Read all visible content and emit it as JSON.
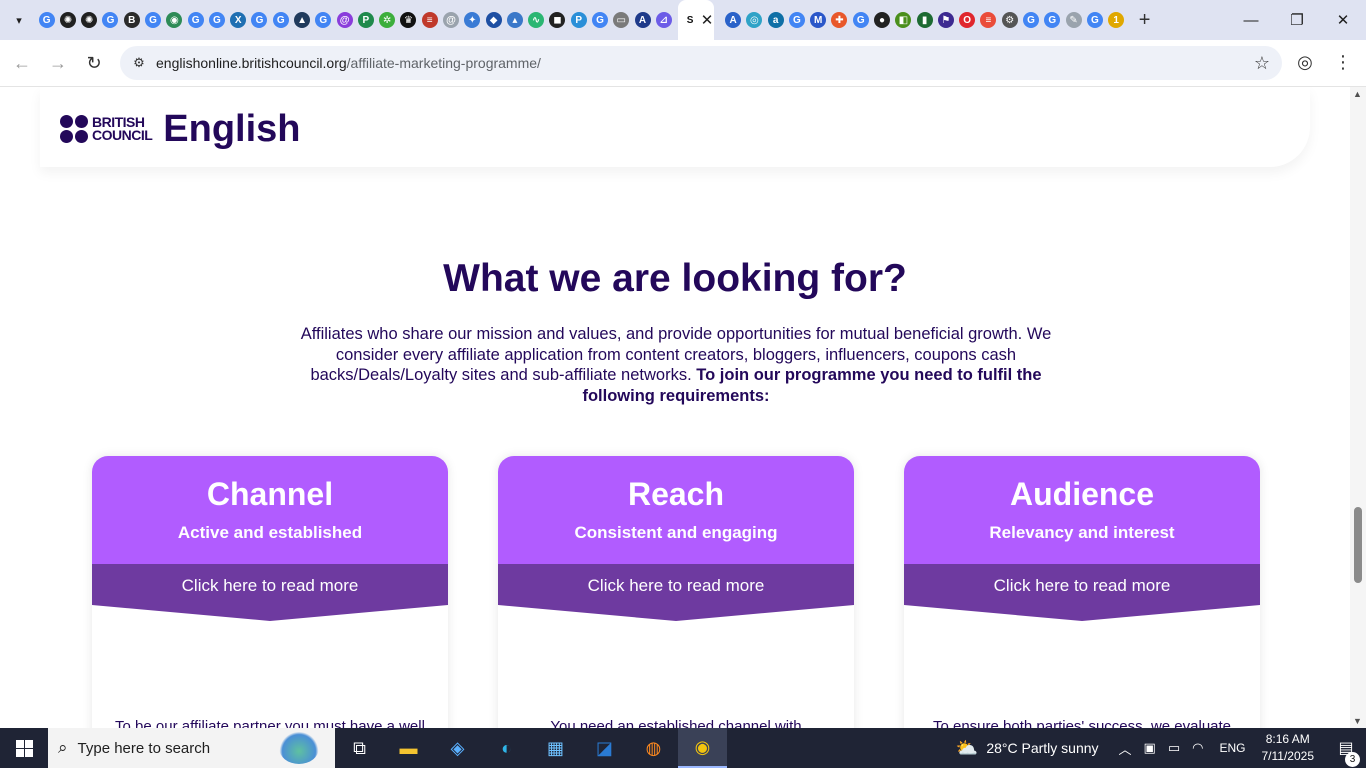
{
  "browser": {
    "tab_icons": [
      {
        "icon": "google-icon",
        "glyph": "G",
        "color": "#4285f4"
      },
      {
        "icon": "chatgpt-icon",
        "glyph": "✺",
        "color": "#202020"
      },
      {
        "icon": "chatgpt-icon",
        "glyph": "✺",
        "color": "#202020"
      },
      {
        "icon": "google-icon",
        "glyph": "G",
        "color": "#4285f4"
      },
      {
        "icon": "b-icon",
        "glyph": "B",
        "color": "#2b2b2b"
      },
      {
        "icon": "google-icon",
        "glyph": "G",
        "color": "#4285f4"
      },
      {
        "icon": "globe-icon",
        "glyph": "◉",
        "color": "#2e8b57"
      },
      {
        "icon": "google-icon",
        "glyph": "G",
        "color": "#4285f4"
      },
      {
        "icon": "google-icon",
        "glyph": "G",
        "color": "#4285f4"
      },
      {
        "icon": "excel-icon",
        "glyph": "X",
        "color": "#1f6fb2"
      },
      {
        "icon": "google-icon",
        "glyph": "G",
        "color": "#4285f4"
      },
      {
        "icon": "google-icon",
        "glyph": "G",
        "color": "#4285f4"
      },
      {
        "icon": "graduation-cap-icon",
        "glyph": "▲",
        "color": "#203a5c"
      },
      {
        "icon": "google-icon",
        "glyph": "G",
        "color": "#4285f4"
      },
      {
        "icon": "at-icon",
        "glyph": "@",
        "color": "#8a3ddb"
      },
      {
        "icon": "p-icon",
        "glyph": "P",
        "color": "#1f8a4c"
      },
      {
        "icon": "recycle-icon",
        "glyph": "✲",
        "color": "#3cae3c"
      },
      {
        "icon": "crown-icon",
        "glyph": "♛",
        "color": "#111111"
      },
      {
        "icon": "lines-icon",
        "glyph": "≡",
        "color": "#c0392b"
      },
      {
        "icon": "swirl-icon",
        "glyph": "@",
        "color": "#9aa3ad"
      },
      {
        "icon": "compass-icon",
        "glyph": "✦",
        "color": "#3a7bd5"
      },
      {
        "icon": "diamond-icon",
        "glyph": "◆",
        "color": "#1e4fa3"
      },
      {
        "icon": "triangle-icon",
        "glyph": "▴",
        "color": "#3b78c9"
      },
      {
        "icon": "chart-icon",
        "glyph": "∿",
        "color": "#2bb673"
      },
      {
        "icon": "camera-icon",
        "glyph": "◼",
        "color": "#222222"
      },
      {
        "icon": "p-icon",
        "glyph": "P",
        "color": "#2a8fd8"
      },
      {
        "icon": "google-icon",
        "glyph": "G",
        "color": "#4285f4"
      },
      {
        "icon": "monitor-icon",
        "glyph": "▭",
        "color": "#7a7a7a"
      },
      {
        "icon": "a-icon",
        "glyph": "A",
        "color": "#1e3a8a"
      },
      {
        "icon": "ai-icon",
        "glyph": "⊿",
        "color": "#6c5ce7"
      }
    ],
    "active_tab": {
      "icon": "s-icon",
      "glyph": "S",
      "close": "✕"
    },
    "tab_icons_after": [
      {
        "icon": "aa-icon",
        "glyph": "A",
        "color": "#2a62c9"
      },
      {
        "icon": "globe-icon",
        "glyph": "◎",
        "color": "#2fa3c7"
      },
      {
        "icon": "a-icon",
        "glyph": "a",
        "color": "#0f6fa6"
      },
      {
        "icon": "google-icon",
        "glyph": "G",
        "color": "#4285f4"
      },
      {
        "icon": "m-icon",
        "glyph": "M",
        "color": "#2b57c9"
      },
      {
        "icon": "puzzle-icon",
        "glyph": "✚",
        "color": "#e8572a"
      },
      {
        "icon": "google-icon",
        "glyph": "G",
        "color": "#4285f4"
      },
      {
        "icon": "ball-icon",
        "glyph": "●",
        "color": "#222222"
      },
      {
        "icon": "square-icon",
        "glyph": "◧",
        "color": "#4a8f1c"
      },
      {
        "icon": "bar-chart-icon",
        "glyph": "▮",
        "color": "#1d6b32"
      },
      {
        "icon": "flag-icon",
        "glyph": "⚑",
        "color": "#3d2a91"
      },
      {
        "icon": "opera-icon",
        "glyph": "O",
        "color": "#e0262d"
      },
      {
        "icon": "stripes-icon",
        "glyph": "≡",
        "color": "#ea4c3a"
      },
      {
        "icon": "gear-icon",
        "glyph": "⚙",
        "color": "#555555"
      },
      {
        "icon": "google-icon",
        "glyph": "G",
        "color": "#4285f4"
      },
      {
        "icon": "google-icon",
        "glyph": "G",
        "color": "#4285f4"
      },
      {
        "icon": "pen-icon",
        "glyph": "✎",
        "color": "#9aa3ad"
      },
      {
        "icon": "google-icon",
        "glyph": "G",
        "color": "#4285f4"
      },
      {
        "icon": "one-icon",
        "glyph": "1",
        "color": "#e0a800"
      }
    ],
    "new_tab": "+",
    "url_domain": "englishonline.britishcouncil.org",
    "url_path": "/affiliate-marketing-programme/"
  },
  "window_controls": {
    "minimize": "—",
    "maximize": "❐",
    "close": "✕"
  },
  "nav": {
    "back": "←",
    "forward": "→",
    "reload": "↻",
    "site_info": "⚙",
    "star": "☆",
    "profile": "◎",
    "menu": "⋮"
  },
  "site": {
    "logo_line1": "BRITISH",
    "logo_line2": "COUNCIL",
    "brand_word": "English"
  },
  "section": {
    "title": "What we are looking for?",
    "intro_plain": "Affiliates who share our mission and values, and provide opportunities for mutual beneficial growth. We consider every affiliate application from content creators, bloggers, influencers, coupons cash backs/Deals/Loyalty sites and sub-affiliate networks.",
    "intro_bold": "To join our programme you need to fulfil the following requirements:"
  },
  "cards": [
    {
      "title": "Channel",
      "subtitle": "Active and established",
      "cta": "Click here to read more",
      "body": "To be our affiliate partner you must have a well"
    },
    {
      "title": "Reach",
      "subtitle": "Consistent and engaging",
      "cta": "Click here to read more",
      "body": "You need an established channel with consistent"
    },
    {
      "title": "Audience",
      "subtitle": "Relevancy and interest",
      "cta": "Click here to read more",
      "body": "To ensure both parties' success, we evaluate"
    }
  ],
  "colors": {
    "brand_navy": "#23085a",
    "card_purple": "#b15cff",
    "band_purple": "#6e3aa0"
  },
  "taskbar": {
    "search_placeholder": "Type here to search",
    "apps": [
      "task-view-icon",
      "file-explorer-icon",
      "copilot-icon",
      "edge-icon",
      "store-icon",
      "outlook-icon",
      "firefox-icon",
      "chrome-icon"
    ],
    "weather_temp": "28°C",
    "weather_desc": "Partly sunny",
    "language": "ENG",
    "time": "8:16 AM",
    "date": "7/11/2025",
    "notification_count": "3"
  }
}
